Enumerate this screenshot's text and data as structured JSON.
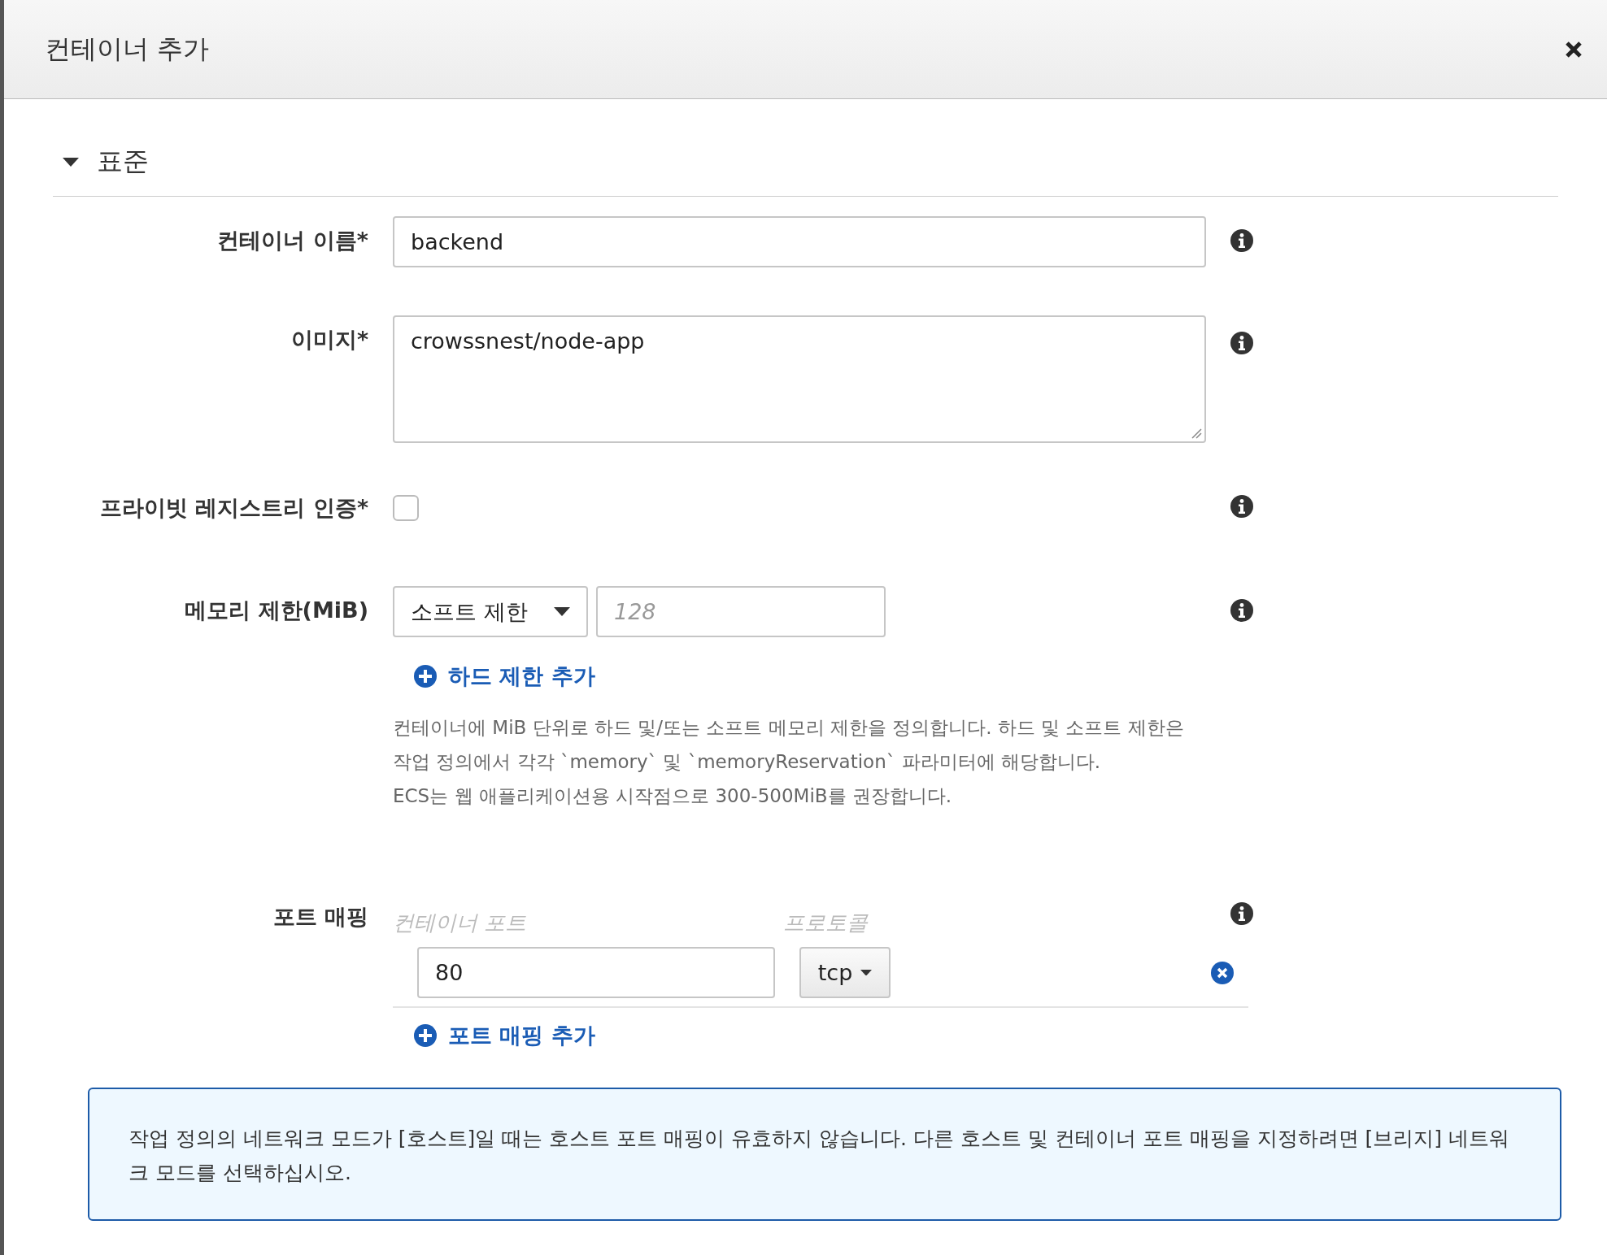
{
  "dialog": {
    "title": "컨테이너 추가",
    "section": {
      "title": "표준",
      "expanded": true
    },
    "fields": [
      {
        "kind": "text",
        "label": "컨테이너 이름*",
        "value": "backend"
      },
      {
        "kind": "textarea",
        "label": "이미지*",
        "value": "crowssnest/node-app"
      },
      {
        "kind": "checkbox",
        "label": "프라이빗 레지스트리 인증*",
        "checked": false
      },
      {
        "kind": "memory",
        "label": "메모리 제한(MiB)",
        "select": "소프트 제한",
        "placeholder": "128",
        "link": "하드 제한 추가",
        "help": [
          "컨테이너에 MiB 단위로 하드 및/또는 소프트 메모리 제한을 정의합니다. 하드 및 소프트 제한은 작업 정의에서 각각 `memory` 및 `memoryReservation` 파라미터에 해당합니다.",
          "ECS는 웹 애플리케이션용 시작점으로 300-500MiB를 권장합니다."
        ]
      }
    ],
    "port_mapping": {
      "label": "포트 매핑",
      "columns": [
        "컨테이너 포트",
        "프로토콜"
      ],
      "rows": [
        {
          "port": "80",
          "protocol": "tcp"
        }
      ],
      "add_link": "포트 매핑 추가"
    },
    "notice": "작업 정의의 네트워크 모드가 [호스트]일 때는 호스트 포트 매핑이 유효하지 않습니다. 다른 호스트 및 컨테이너 포트 매핑을 지정하려면 [브리지] 네트워크 모드를 선택하십시오."
  }
}
